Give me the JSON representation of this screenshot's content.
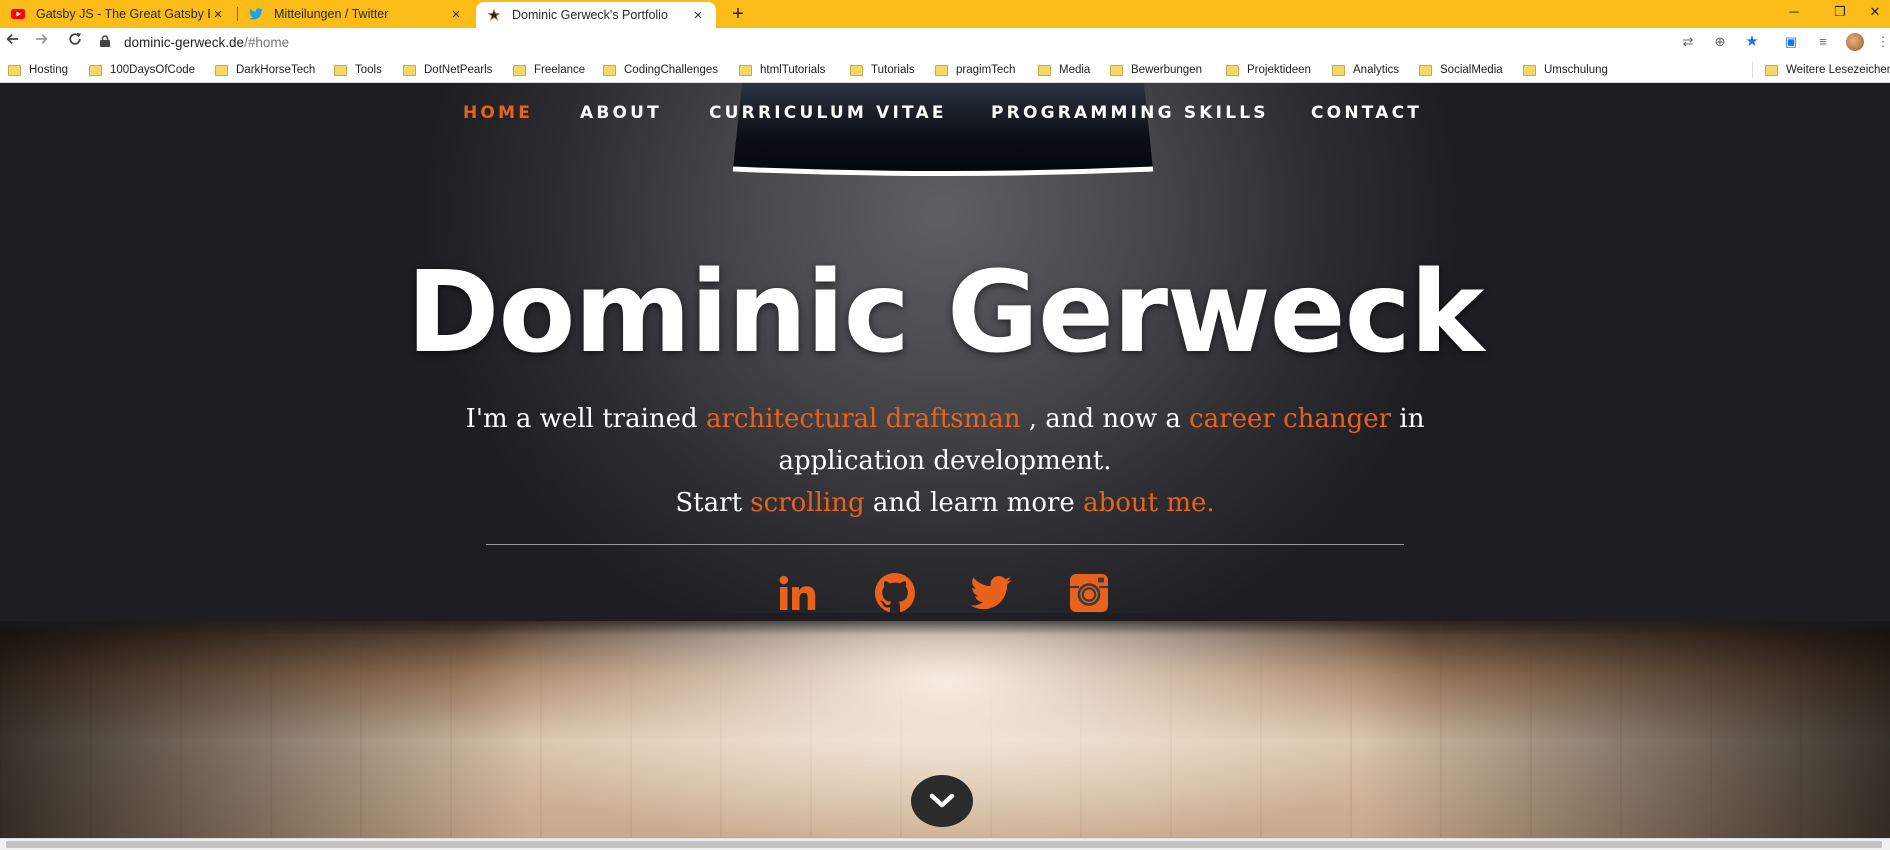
{
  "tabs": [
    {
      "title": "Gatsby JS - The Great Gatsby Bo",
      "icon": "youtube-icon"
    },
    {
      "title": "Mitteilungen / Twitter",
      "icon": "twitter-icon"
    },
    {
      "title": "Dominic Gerweck's Portfolio",
      "icon": "star-icon",
      "active": true
    }
  ],
  "new_tab_symbol": "+",
  "omnibox": {
    "host": "dominic-gerweck.de",
    "path": "/#home"
  },
  "bookmarks": [
    "Hosting",
    "100DaysOfCode",
    "DarkHorseTech",
    "Tools",
    "DotNetPearls",
    "Freelance",
    "CodingChallenges",
    "htmlTutorials",
    "Tutorials",
    "pragimTech",
    "Media",
    "Bewerbungen",
    "Projektideen",
    "Analytics",
    "SocialMedia",
    "Umschulung",
    "Weitere Lesezeichen"
  ],
  "nav": [
    {
      "label": "HOME",
      "active": true
    },
    {
      "label": "ABOUT"
    },
    {
      "label": "CURRICULUM VITAE"
    },
    {
      "label": "PROGRAMMING SKILLS"
    },
    {
      "label": "CONTACT"
    }
  ],
  "hero": {
    "title": "Dominic Gerweck",
    "p1_a": "I'm a well trained ",
    "p1_hl1": "architectural draftsman",
    "p1_b": " , and now a ",
    "p1_hl2": "career changer",
    "p1_c": " in application development.",
    "p2_a": "Start ",
    "p2_hl1": "scrolling",
    "p2_b": " and learn more ",
    "p2_hl2": "about me."
  },
  "social": [
    "linkedin-icon",
    "github-icon",
    "twitter-icon",
    "instagram-icon"
  ],
  "colors": {
    "accent": "#e8621c",
    "tabstrip": "#fbbc17",
    "text": "#ffffff"
  }
}
